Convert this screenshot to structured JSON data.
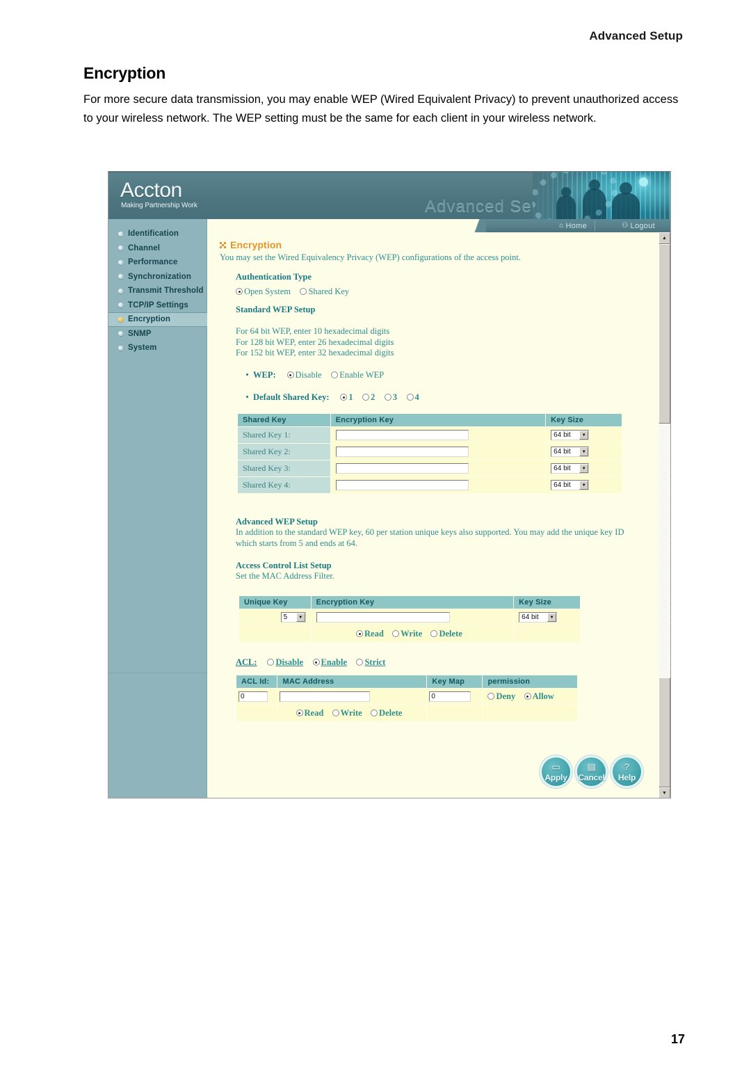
{
  "document": {
    "running_header": "Advanced Setup",
    "title": "Encryption",
    "paragraph": "For more secure data transmission, you may enable WEP (Wired Equivalent Privacy) to prevent unauthorized access to your wireless network. The WEP setting must be the same for each client in your wireless network.",
    "page_number": "17"
  },
  "screenshot": {
    "banner": {
      "logo": "Accton",
      "tagline": "Making Partnership Work",
      "title": "Advanced Setup"
    },
    "topnav": {
      "home": "Home",
      "logout": "Logout",
      "home_icon": "house-icon",
      "logout_icon": "person-walking-icon"
    },
    "sidebar": {
      "items": [
        {
          "label": "Identification",
          "selected": false
        },
        {
          "label": "Channel",
          "selected": false
        },
        {
          "label": "Performance",
          "selected": false
        },
        {
          "label": "Synchronization",
          "selected": false
        },
        {
          "label": "Transmit Threshold",
          "selected": false
        },
        {
          "label": "TCP/IP Settings",
          "selected": false
        },
        {
          "label": "Encryption",
          "selected": true
        },
        {
          "label": "SNMP",
          "selected": false
        },
        {
          "label": "System",
          "selected": false
        }
      ]
    },
    "page": {
      "heading": "Encryption",
      "heading_icon": "grid-icon",
      "description": "You may set the Wired Equivalency Privacy (WEP) configurations of the access point.",
      "auth": {
        "heading": "Authentication Type",
        "options": [
          {
            "label": "Open System",
            "checked": true
          },
          {
            "label": "Shared Key",
            "checked": false
          }
        ]
      },
      "standard_wep": {
        "heading": "Standard WEP Setup",
        "notes": [
          "For 64 bit WEP, enter 10 hexadecimal digits",
          "For 128 bit WEP, enter 26 hexadecimal digits",
          "For 152 bit WEP, enter 32 hexadecimal digits"
        ],
        "wep_label": "WEP:",
        "wep_options": [
          {
            "label": "Disable",
            "checked": true
          },
          {
            "label": "Enable WEP",
            "checked": false
          }
        ],
        "default_key_label": "Default Shared Key:",
        "default_key_options": [
          {
            "label": "1",
            "checked": true
          },
          {
            "label": "2",
            "checked": false
          },
          {
            "label": "3",
            "checked": false
          },
          {
            "label": "4",
            "checked": false
          }
        ],
        "table": {
          "headers": [
            "Shared Key",
            "Encryption Key",
            "Key Size"
          ],
          "rows": [
            {
              "name": "Shared Key 1:",
              "key": "",
              "size": "64 bit"
            },
            {
              "name": "Shared Key 2:",
              "key": "",
              "size": "64 bit"
            },
            {
              "name": "Shared Key 3:",
              "key": "",
              "size": "64 bit"
            },
            {
              "name": "Shared Key 4:",
              "key": "",
              "size": "64 bit"
            }
          ]
        }
      },
      "advanced_wep": {
        "heading": "Advanced WEP Setup",
        "text": "In addition to the standard WEP key, 60 per station unique keys also supported. You may add the unique key ID which starts from 5 and ends at 64."
      },
      "acl_setup": {
        "heading": "Access Control List Setup",
        "text": "Set the MAC Address Filter."
      },
      "unique_key_table": {
        "headers": [
          "Unique Key",
          "Encryption Key",
          "Key Size"
        ],
        "row": {
          "unique_key": "5",
          "key": "",
          "size": "64 bit"
        },
        "actions": [
          {
            "label": "Read",
            "checked": true
          },
          {
            "label": "Write",
            "checked": false
          },
          {
            "label": "Delete",
            "checked": false
          }
        ]
      },
      "acl": {
        "label": "ACL:",
        "options": [
          {
            "label": "Disable",
            "checked": false
          },
          {
            "label": "Enable",
            "checked": true
          },
          {
            "label": "Strict",
            "checked": false
          }
        ],
        "table": {
          "headers": [
            "ACL Id:",
            "MAC Address",
            "Key Map",
            "permission"
          ],
          "row": {
            "acl_id": "0",
            "mac_address": "",
            "key_map": "0",
            "permission": [
              {
                "label": "Deny",
                "checked": false
              },
              {
                "label": "Allow",
                "checked": true
              }
            ]
          },
          "actions": [
            {
              "label": "Read",
              "checked": true
            },
            {
              "label": "Write",
              "checked": false
            },
            {
              "label": "Delete",
              "checked": false
            }
          ]
        }
      },
      "buttons": [
        {
          "label": "Apply",
          "icon": "capsule-icon"
        },
        {
          "label": "Cancel",
          "icon": "trash-icon"
        },
        {
          "label": "Help",
          "icon": "question-icon"
        }
      ]
    }
  }
}
